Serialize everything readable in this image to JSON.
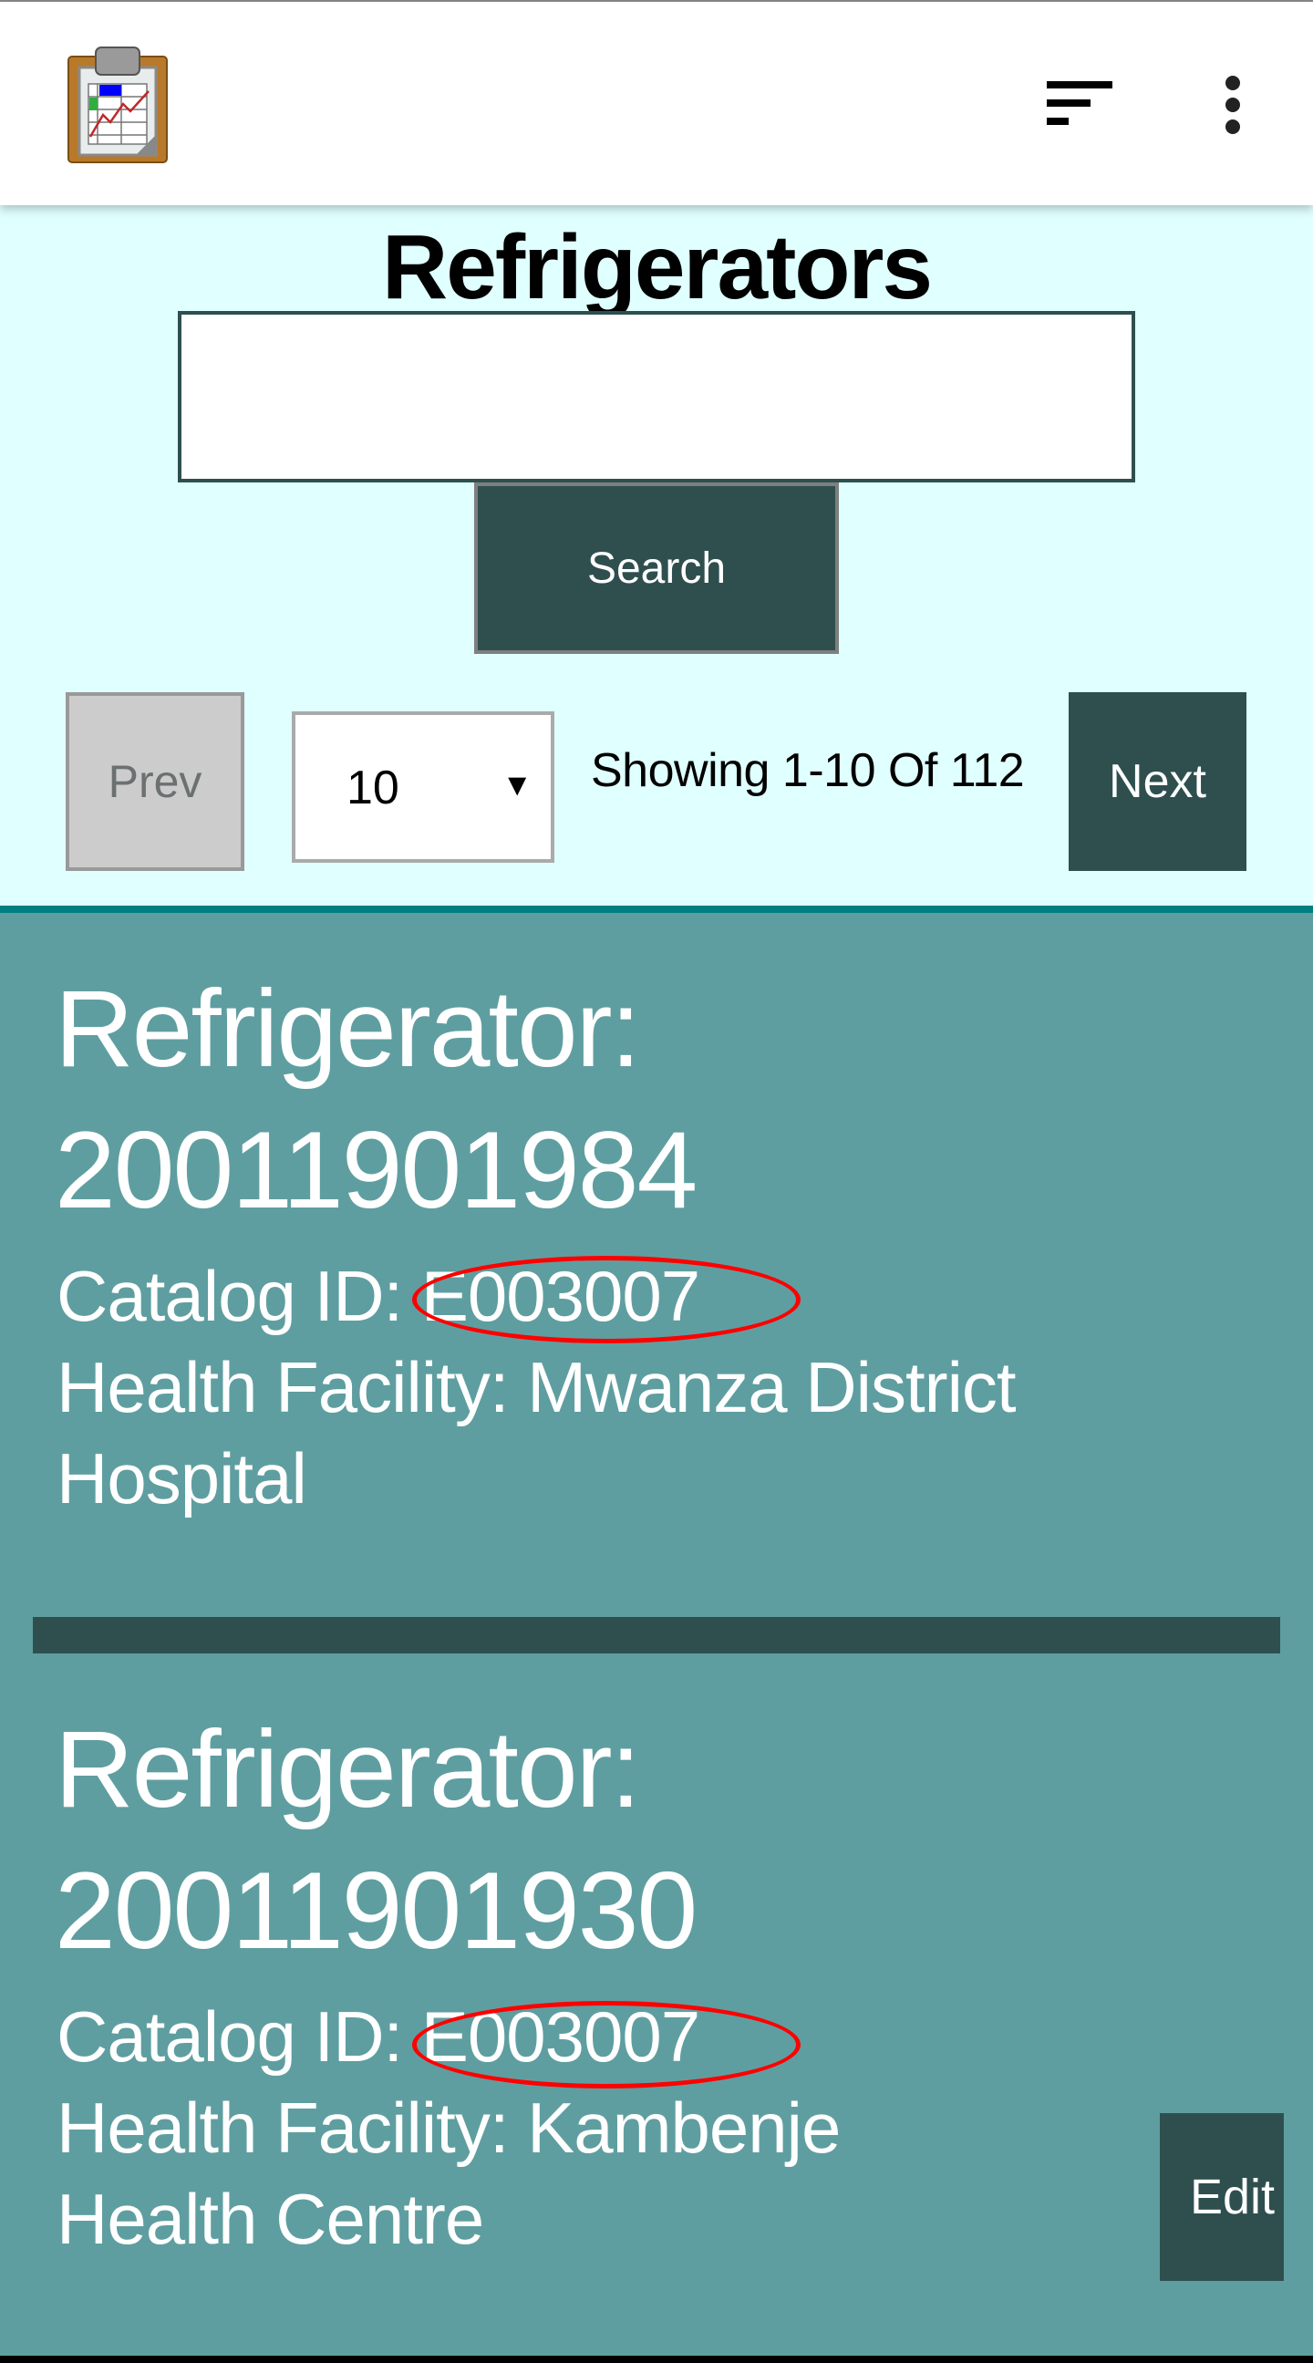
{
  "header": {
    "logo_icon": "clipboard-chart-icon",
    "sort_icon": "sort-icon",
    "menu_icon": "more-vert-icon"
  },
  "page": {
    "title": "Refrigerators"
  },
  "search": {
    "value": "",
    "placeholder": "",
    "button_label": "Search"
  },
  "pagination": {
    "prev_label": "Prev",
    "page_size": "10",
    "dropdown_arrow": "▼",
    "showing_text": "Showing 1-10 Of 112",
    "next_label": "Next"
  },
  "colors": {
    "header_bg": "#FFFFFF",
    "toolbar_bg": "#E0FFFF",
    "accent_dark": "#2F4F4F",
    "card_bg": "#5F9EA0",
    "rule": "#008080",
    "annotation": "#FF0000"
  },
  "refrigerators": [
    {
      "title_label": "Refrigerator:",
      "number": "20011901984",
      "catalog_line": "Catalog ID: E003007",
      "facility_line1": "Health Facility: Mwanza District",
      "facility_line2": "Hospital",
      "highlighted": "E003007"
    },
    {
      "title_label": "Refrigerator:",
      "number": "20011901930",
      "catalog_line": "Catalog ID: E003007",
      "facility_line1": "Health Facility: Kambenje",
      "facility_line2": "Health Centre",
      "highlighted": "E003007",
      "edit_label": "Edit"
    }
  ]
}
